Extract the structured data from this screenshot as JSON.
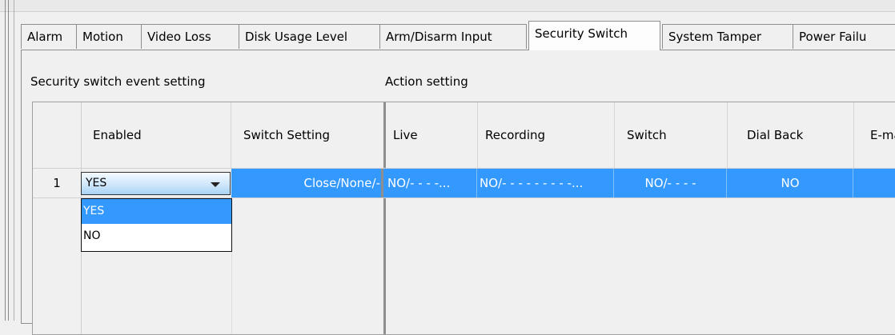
{
  "tabs": [
    {
      "label": "Alarm",
      "active": false
    },
    {
      "label": "Motion",
      "active": false
    },
    {
      "label": "Video Loss",
      "active": false
    },
    {
      "label": "Disk Usage Level",
      "active": false
    },
    {
      "label": "Arm/Disarm Input",
      "active": false
    },
    {
      "label": "Security Switch",
      "active": true
    },
    {
      "label": "System Tamper",
      "active": false
    },
    {
      "label": "Power Failu",
      "active": false
    }
  ],
  "sections": {
    "event_setting_title": "Security switch event setting",
    "action_setting_title": "Action setting"
  },
  "grid": {
    "columns": [
      "Enabled",
      "Switch Setting",
      "Live",
      "Recording",
      "Switch",
      "Dial Back",
      "E-ma"
    ],
    "rows": [
      {
        "row_number": "1",
        "enabled": "YES",
        "switch_setting": "Close/None/-",
        "live": "NO/- - - -...",
        "recording": "NO/- - - - - - - - -...",
        "switch": "NO/- - - -",
        "dial_back": "NO"
      }
    ]
  },
  "enabled_dropdown": {
    "options": [
      "YES",
      "NO"
    ],
    "highlighted": "YES"
  },
  "colors": {
    "selection": "#3399ff",
    "background": "#f0f0f0"
  }
}
